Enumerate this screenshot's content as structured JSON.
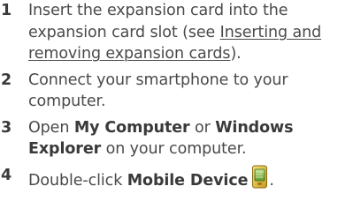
{
  "steps": [
    {
      "number": "1",
      "text_before": "Insert the expansion card into the expansion card slot (see ",
      "link": "Inserting and removing expansion cards",
      "text_after": ")."
    },
    {
      "number": "2",
      "text": "Connect your smartphone to your computer."
    },
    {
      "number": "3",
      "prefix": "Open ",
      "bold1": "My Computer",
      "middle": " or ",
      "bold2": "Windows Explorer",
      "suffix": " on your computer."
    },
    {
      "number": "4",
      "prefix": "Double-click ",
      "bold": "Mobile Device",
      "icon": "mobile-device-icon",
      "suffix": "."
    }
  ]
}
